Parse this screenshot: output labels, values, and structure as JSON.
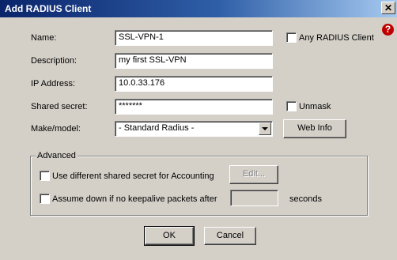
{
  "window": {
    "title": "Add RADIUS Client",
    "close_glyph": "✕"
  },
  "form": {
    "name": {
      "label": "Name:",
      "value": "SSL-VPN-1"
    },
    "description": {
      "label": "Description:",
      "value": "my first SSL-VPN"
    },
    "ip": {
      "label": "IP Address:",
      "value": "10.0.33.176"
    },
    "secret": {
      "label": "Shared secret:",
      "value": "*******"
    },
    "make": {
      "label": "Make/model:",
      "value": "- Standard Radius -"
    },
    "any_radius": {
      "label": "Any RADIUS Client",
      "checked": false
    },
    "unmask": {
      "label": "Unmask",
      "checked": false
    },
    "web_info": "Web Info"
  },
  "advanced": {
    "title": "Advanced",
    "accounting_label": "Use different shared secret for Accounting",
    "edit_label": "Edit...",
    "keepalive_label": "Assume down if no keepalive packets after",
    "seconds_label": "seconds",
    "keepalive_value": ""
  },
  "buttons": {
    "ok": "OK",
    "cancel": "Cancel"
  },
  "icons": {
    "help": "?"
  }
}
